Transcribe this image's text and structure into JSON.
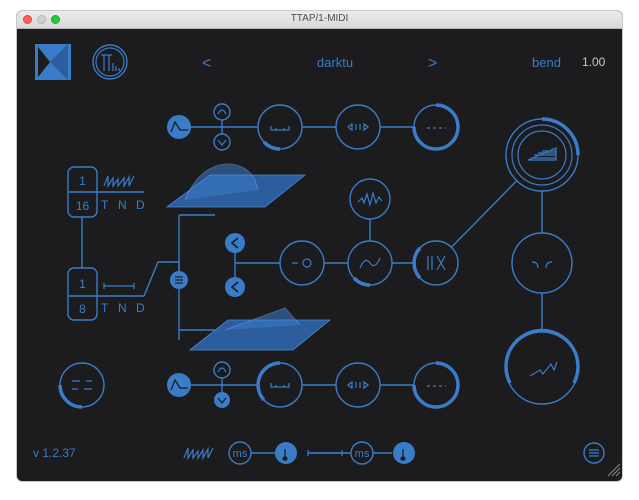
{
  "window": {
    "title": "TTAP/1-MIDI"
  },
  "header": {
    "prev_symbol": "<",
    "preset_name": "darktu",
    "next_symbol": ">",
    "param_label": "bend",
    "param_value": "1.00"
  },
  "tap_grid": [
    {
      "numerator": "1",
      "denominator": "16",
      "modes": [
        "T",
        "N",
        "D"
      ]
    },
    {
      "numerator": "1",
      "denominator": "8",
      "modes": [
        "T",
        "N",
        "D"
      ]
    }
  ],
  "footer": {
    "version": "v 1.2.37",
    "unit_label_1": "ms",
    "unit_label_2": "ms"
  },
  "colors": {
    "background": "#1c1c1e",
    "accent": "#3a7cc7",
    "accent_fill": "#2f69b3",
    "text_light": "#c8c8c8"
  },
  "icons": [
    "logo-icon",
    "tempo-sync-icon",
    "lfo-wave-icon",
    "filter-icon",
    "gate-icon",
    "pan-icon",
    "fade-icon",
    "feedback-icon",
    "glide-icon",
    "phase-icon",
    "freeze-icon",
    "menu-icon"
  ]
}
